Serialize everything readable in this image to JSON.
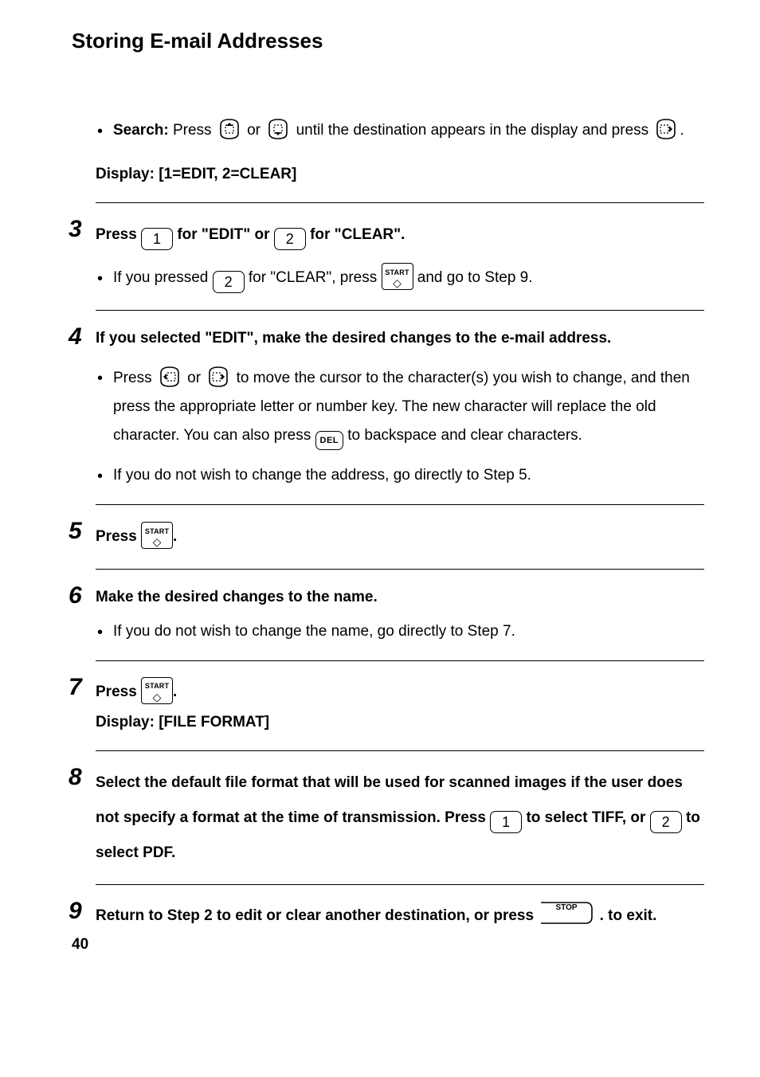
{
  "title": "Storing E-mail Addresses",
  "page_number": "40",
  "keys": {
    "k1": "1",
    "k2": "2",
    "del": "DEL",
    "start_label": "START",
    "stop_label": "STOP"
  },
  "search": {
    "label": "Search:",
    "before_icons": " Press ",
    "or": " or ",
    "after_icons": " until the destination appears in the display and press ",
    "display": "Display: [1=EDIT, 2=CLEAR]"
  },
  "step3": {
    "num": "3",
    "t1": "Press ",
    "t2": " for \"EDIT\" or ",
    "t3": " for  \"CLEAR\".",
    "sub_t1": "If you pressed ",
    "sub_t2": " for \"CLEAR\", press ",
    "sub_t3": " and go to Step 9."
  },
  "step4": {
    "num": "4",
    "headline": "If you selected \"EDIT\", make the desired changes to the e-mail address.",
    "b1_t1": "Press ",
    "b1_or": " or ",
    "b1_t2": " to move the cursor to the character(s) you wish to change, and then press the appropriate letter or number key. The new character will replace the old character. You can also press ",
    "b1_t3": " to backspace and clear characters.",
    "b2": "If you do not wish to change the address, go directly to Step 5."
  },
  "step5": {
    "num": "5",
    "t1": "Press ",
    "t2": "."
  },
  "step6": {
    "num": "6",
    "headline": "Make the desired changes to the name.",
    "b1": "If you do not wish to change the name, go directly to Step 7."
  },
  "step7": {
    "num": "7",
    "t1": "Press ",
    "t2": ".",
    "display": "Display: [FILE FORMAT]"
  },
  "step8": {
    "num": "8",
    "t1": "Select the default file format that will be used for scanned images if the user does not specify a format at the time of transmission. Press ",
    "t2": " to select TIFF, or ",
    "t3": " to select PDF."
  },
  "step9": {
    "num": "9",
    "t1": "Return to Step 2 to edit or clear another destination, or press ",
    "t2": " . to exit."
  }
}
